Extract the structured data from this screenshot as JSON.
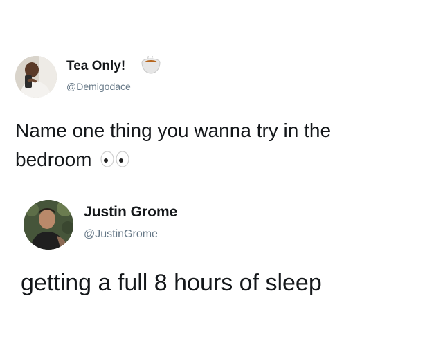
{
  "tweets": [
    {
      "display_name": "Tea Only!",
      "handle": "@Demigodace",
      "name_emoji": "tea-cup-icon",
      "body_lines": [
        "Name one thing you wanna try in the",
        "bedroom"
      ],
      "body_emoji": "eyes-icon"
    },
    {
      "display_name": "Justin Grome",
      "handle": "@JustinGrome",
      "body": "getting a full 8 hours of sleep"
    }
  ],
  "colors": {
    "background": "#ffffff",
    "text": "#14171a",
    "handle": "#657786"
  }
}
